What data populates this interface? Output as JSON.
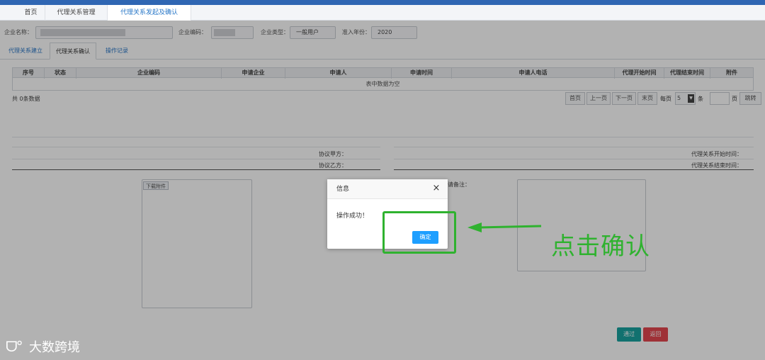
{
  "tabs": [
    {
      "label": "首页"
    },
    {
      "label": "代理关系管理"
    },
    {
      "label": "代理关系发起及确认"
    }
  ],
  "filter": {
    "company_name_label": "企业名称：",
    "company_code_label": "企业编码：",
    "company_type_label": "企业类型：",
    "company_type_value": "一般用户",
    "year_label": "准入年份：",
    "year_value": "2020"
  },
  "subtabs": [
    {
      "label": "代理关系建立"
    },
    {
      "label": "代理关系确认"
    },
    {
      "label": "操作记录"
    }
  ],
  "table": {
    "columns": [
      "序号",
      "状态",
      "企业编码",
      "申请企业",
      "申请人",
      "申请时间",
      "申请人电话",
      "代理开始时间",
      "代理结束时间",
      "附件"
    ],
    "empty_text": "表中数据为空",
    "total_text": "共 0条数据"
  },
  "pagination": {
    "first": "首页",
    "prev": "上一页",
    "next": "下一页",
    "last": "末页",
    "per_page_label": "每页",
    "per_page_value": "5",
    "unit": "条",
    "page_unit": "页",
    "jump": "跳转"
  },
  "detail": {
    "party_a_label": "协议甲方：",
    "party_b_label": "协议乙方：",
    "start_label": "代理关系开始时间：",
    "end_label": "代理关系结束时间：",
    "download_label": "下载附件",
    "remark_label": "请备注："
  },
  "actions": {
    "pass": "通过",
    "back": "返回"
  },
  "dialog": {
    "title": "信息",
    "close": "×",
    "message": "操作成功！",
    "ok": "确定"
  },
  "annotation": {
    "text": "点击确认"
  },
  "logo": {
    "text": "大数跨境"
  },
  "colors": {
    "accent": "#1e9fff",
    "annotation_green": "#2fb22f",
    "pass_button": "#19a3a0",
    "back_button": "#e4474f"
  }
}
